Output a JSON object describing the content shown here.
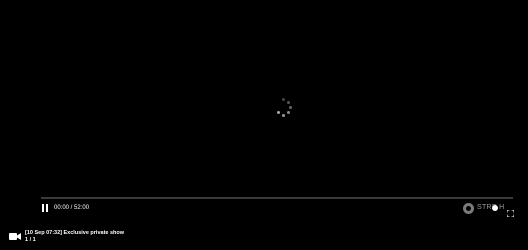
{
  "player": {
    "time_display": "00:00 / 52:00",
    "progress": 0,
    "brand_text": "STRE  H"
  },
  "icons": {
    "spinner": "loading-spinner-icon",
    "pause": "pause-icon",
    "brand": "streamhub-logo-icon",
    "fullscreen": "fullscreen-icon",
    "camera": "video-camera-icon"
  },
  "stream": {
    "title": "[10 Sep 07:32] Exclusive private show",
    "count": "1 / 1"
  },
  "colors": {
    "background": "#000000",
    "text": "#ffffff",
    "track": "#3a3a3a",
    "muted": "#9a9a9a"
  }
}
